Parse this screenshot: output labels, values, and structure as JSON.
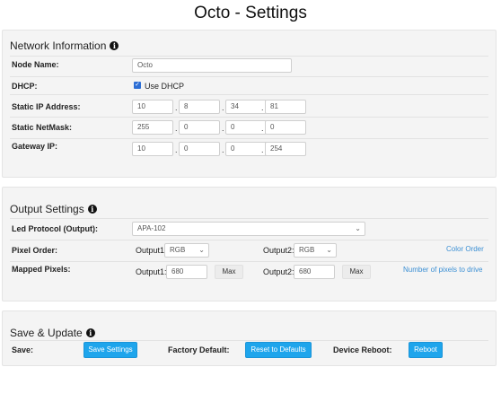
{
  "page": {
    "title": "Octo - Settings"
  },
  "network": {
    "header": "Network Information",
    "node_name_label": "Node Name:",
    "node_name_value": "Octo",
    "dhcp_label": "DHCP:",
    "dhcp_checkbox_label": "Use DHCP",
    "dhcp_checked": true,
    "static_ip_label": "Static IP Address:",
    "static_ip": [
      "10",
      "8",
      "34",
      "81"
    ],
    "netmask_label": "Static NetMask:",
    "netmask": [
      "255",
      "0",
      "0",
      "0"
    ],
    "gateway_label": "Gateway IP:",
    "gateway": [
      "10",
      "0",
      "0",
      "254"
    ],
    "separator": "."
  },
  "output": {
    "header": "Output Settings",
    "led_protocol_label": "Led Protocol (Output):",
    "led_protocol_value": "APA-102",
    "pixel_order_label": "Pixel Order:",
    "output1_label": "Output1:",
    "output2_label": "Output2:",
    "output1_order": "RGB",
    "output2_order": "RGB",
    "color_order_link": "Color Order",
    "mapped_pixels_label": "Mapped Pixels:",
    "output1_pixels": "680",
    "output2_pixels": "680",
    "max_label": "Max",
    "pixels_help_link": "Number of pixels to drive"
  },
  "save": {
    "header": "Save & Update",
    "save_label": "Save:",
    "save_button": "Save Settings",
    "factory_label": "Factory Default:",
    "reset_button": "Reset to Defaults",
    "reboot_label": "Device Reboot:",
    "reboot_button": "Reboot"
  },
  "colors": {
    "primary_button": "#1ea5ec",
    "link": "#3b8fd4",
    "panel_bg": "#f4f4f4"
  }
}
